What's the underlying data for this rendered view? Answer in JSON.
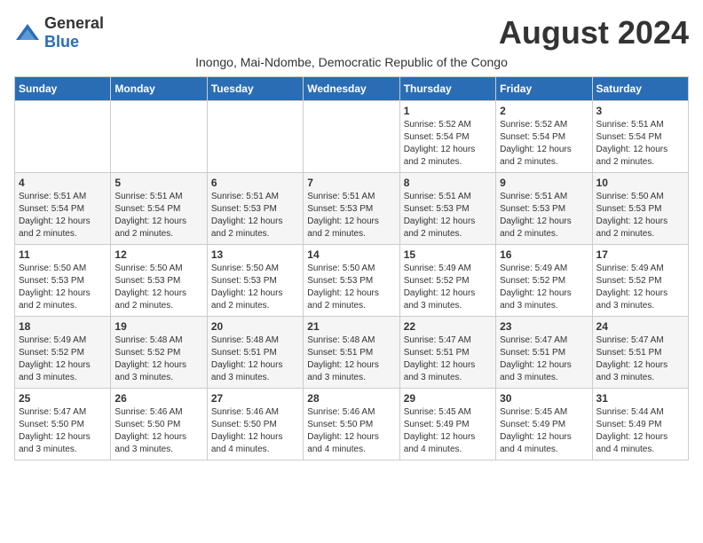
{
  "logo": {
    "general": "General",
    "blue": "Blue"
  },
  "title": "August 2024",
  "subtitle": "Inongo, Mai-Ndombe, Democratic Republic of the Congo",
  "headers": [
    "Sunday",
    "Monday",
    "Tuesday",
    "Wednesday",
    "Thursday",
    "Friday",
    "Saturday"
  ],
  "weeks": [
    [
      {
        "day": "",
        "info": ""
      },
      {
        "day": "",
        "info": ""
      },
      {
        "day": "",
        "info": ""
      },
      {
        "day": "",
        "info": ""
      },
      {
        "day": "1",
        "info": "Sunrise: 5:52 AM\nSunset: 5:54 PM\nDaylight: 12 hours\nand 2 minutes."
      },
      {
        "day": "2",
        "info": "Sunrise: 5:52 AM\nSunset: 5:54 PM\nDaylight: 12 hours\nand 2 minutes."
      },
      {
        "day": "3",
        "info": "Sunrise: 5:51 AM\nSunset: 5:54 PM\nDaylight: 12 hours\nand 2 minutes."
      }
    ],
    [
      {
        "day": "4",
        "info": "Sunrise: 5:51 AM\nSunset: 5:54 PM\nDaylight: 12 hours\nand 2 minutes."
      },
      {
        "day": "5",
        "info": "Sunrise: 5:51 AM\nSunset: 5:54 PM\nDaylight: 12 hours\nand 2 minutes."
      },
      {
        "day": "6",
        "info": "Sunrise: 5:51 AM\nSunset: 5:53 PM\nDaylight: 12 hours\nand 2 minutes."
      },
      {
        "day": "7",
        "info": "Sunrise: 5:51 AM\nSunset: 5:53 PM\nDaylight: 12 hours\nand 2 minutes."
      },
      {
        "day": "8",
        "info": "Sunrise: 5:51 AM\nSunset: 5:53 PM\nDaylight: 12 hours\nand 2 minutes."
      },
      {
        "day": "9",
        "info": "Sunrise: 5:51 AM\nSunset: 5:53 PM\nDaylight: 12 hours\nand 2 minutes."
      },
      {
        "day": "10",
        "info": "Sunrise: 5:50 AM\nSunset: 5:53 PM\nDaylight: 12 hours\nand 2 minutes."
      }
    ],
    [
      {
        "day": "11",
        "info": "Sunrise: 5:50 AM\nSunset: 5:53 PM\nDaylight: 12 hours\nand 2 minutes."
      },
      {
        "day": "12",
        "info": "Sunrise: 5:50 AM\nSunset: 5:53 PM\nDaylight: 12 hours\nand 2 minutes."
      },
      {
        "day": "13",
        "info": "Sunrise: 5:50 AM\nSunset: 5:53 PM\nDaylight: 12 hours\nand 2 minutes."
      },
      {
        "day": "14",
        "info": "Sunrise: 5:50 AM\nSunset: 5:53 PM\nDaylight: 12 hours\nand 2 minutes."
      },
      {
        "day": "15",
        "info": "Sunrise: 5:49 AM\nSunset: 5:52 PM\nDaylight: 12 hours\nand 3 minutes."
      },
      {
        "day": "16",
        "info": "Sunrise: 5:49 AM\nSunset: 5:52 PM\nDaylight: 12 hours\nand 3 minutes."
      },
      {
        "day": "17",
        "info": "Sunrise: 5:49 AM\nSunset: 5:52 PM\nDaylight: 12 hours\nand 3 minutes."
      }
    ],
    [
      {
        "day": "18",
        "info": "Sunrise: 5:49 AM\nSunset: 5:52 PM\nDaylight: 12 hours\nand 3 minutes."
      },
      {
        "day": "19",
        "info": "Sunrise: 5:48 AM\nSunset: 5:52 PM\nDaylight: 12 hours\nand 3 minutes."
      },
      {
        "day": "20",
        "info": "Sunrise: 5:48 AM\nSunset: 5:51 PM\nDaylight: 12 hours\nand 3 minutes."
      },
      {
        "day": "21",
        "info": "Sunrise: 5:48 AM\nSunset: 5:51 PM\nDaylight: 12 hours\nand 3 minutes."
      },
      {
        "day": "22",
        "info": "Sunrise: 5:47 AM\nSunset: 5:51 PM\nDaylight: 12 hours\nand 3 minutes."
      },
      {
        "day": "23",
        "info": "Sunrise: 5:47 AM\nSunset: 5:51 PM\nDaylight: 12 hours\nand 3 minutes."
      },
      {
        "day": "24",
        "info": "Sunrise: 5:47 AM\nSunset: 5:51 PM\nDaylight: 12 hours\nand 3 minutes."
      }
    ],
    [
      {
        "day": "25",
        "info": "Sunrise: 5:47 AM\nSunset: 5:50 PM\nDaylight: 12 hours\nand 3 minutes."
      },
      {
        "day": "26",
        "info": "Sunrise: 5:46 AM\nSunset: 5:50 PM\nDaylight: 12 hours\nand 3 minutes."
      },
      {
        "day": "27",
        "info": "Sunrise: 5:46 AM\nSunset: 5:50 PM\nDaylight: 12 hours\nand 4 minutes."
      },
      {
        "day": "28",
        "info": "Sunrise: 5:46 AM\nSunset: 5:50 PM\nDaylight: 12 hours\nand 4 minutes."
      },
      {
        "day": "29",
        "info": "Sunrise: 5:45 AM\nSunset: 5:49 PM\nDaylight: 12 hours\nand 4 minutes."
      },
      {
        "day": "30",
        "info": "Sunrise: 5:45 AM\nSunset: 5:49 PM\nDaylight: 12 hours\nand 4 minutes."
      },
      {
        "day": "31",
        "info": "Sunrise: 5:44 AM\nSunset: 5:49 PM\nDaylight: 12 hours\nand 4 minutes."
      }
    ]
  ]
}
